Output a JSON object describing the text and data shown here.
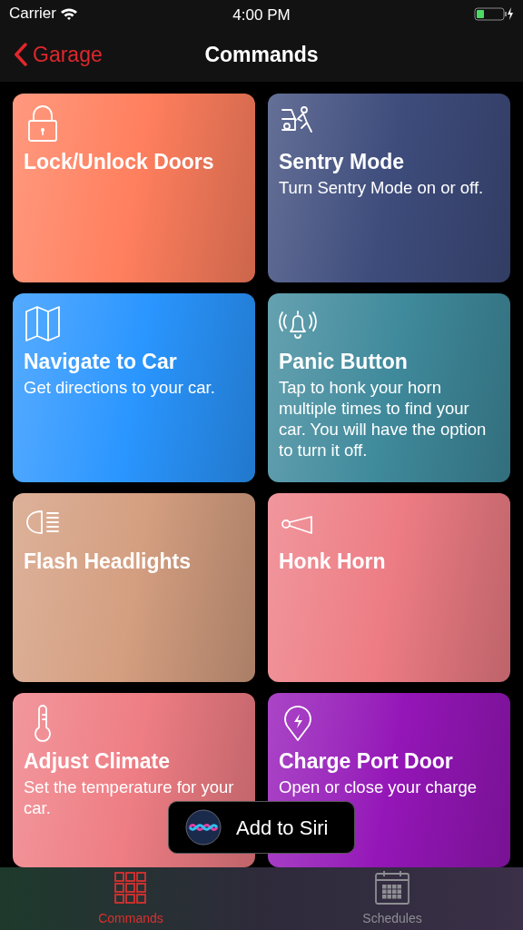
{
  "status_bar": {
    "carrier": "Carrier",
    "time": "4:00 PM"
  },
  "nav": {
    "back": "Garage",
    "title": "Commands"
  },
  "commands": [
    {
      "kind": "lock",
      "title": "Lock/Unlock Doors",
      "color": "#ff7f5e"
    },
    {
      "kind": "sentry",
      "title": "Sentry Mode",
      "description": "Turn Sentry Mode on or off.",
      "color": "#3e4c7c"
    },
    {
      "kind": "map",
      "title": "Navigate to Car",
      "description": "Get directions to your car.",
      "color": "#2a96ff"
    },
    {
      "kind": "bell",
      "title": "Panic Button",
      "description": "Tap to honk your horn multiple times to find your car. You will have the option to turn it off.",
      "color": "#3f8a9c"
    },
    {
      "kind": "headlight",
      "title": "Flash Headlights",
      "color": "#d49e80"
    },
    {
      "kind": "horn",
      "title": "Honk Horn",
      "color": "#ed7c84"
    },
    {
      "kind": "thermometer",
      "title": "Adjust Climate",
      "description": "Set the temperature for your car.",
      "color": "#ee7d84"
    },
    {
      "kind": "pin",
      "title": "Charge Port Door",
      "description": "Open or close your charge",
      "color": "#9516b8"
    }
  ],
  "siri_button": {
    "label": "Add to Siri"
  },
  "tabs": [
    {
      "label": "Commands",
      "kind": "grid",
      "selected": true
    },
    {
      "label": "Schedules",
      "kind": "calendar",
      "selected": false
    }
  ]
}
